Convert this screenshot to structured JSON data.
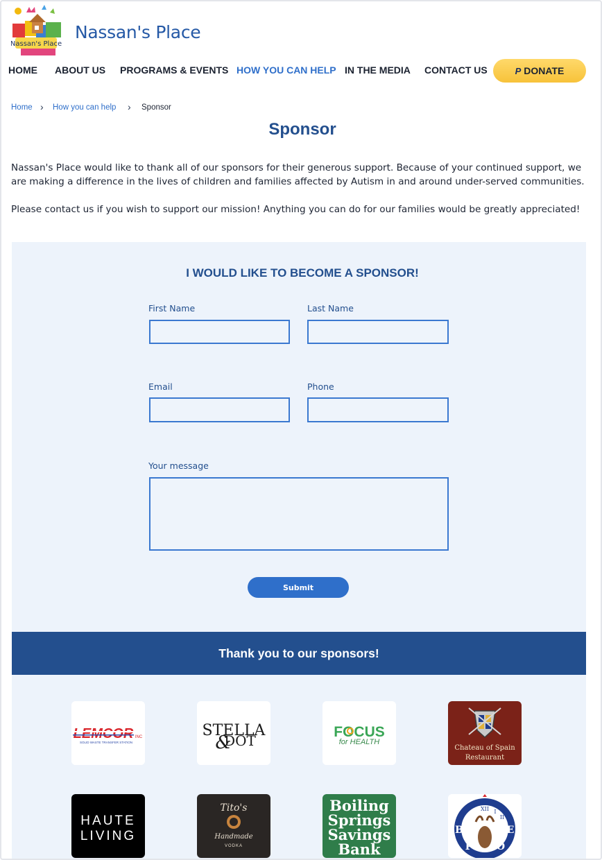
{
  "site": {
    "title": "Nassan's Place",
    "logo_text": "Nassan's Place"
  },
  "nav": {
    "items": [
      "HOME",
      "ABOUT US",
      "PROGRAMS & EVENTS",
      "HOW YOU CAN HELP",
      "IN THE MEDIA",
      "CONTACT US"
    ],
    "active": "HOW YOU CAN HELP",
    "donate_label": "DONATE",
    "donate_icon": "paypal-icon"
  },
  "breadcrumb": [
    "Home",
    "How you can help",
    "Sponsor"
  ],
  "page": {
    "title": "Sponsor",
    "intro": [
      "Nassan's Place would like to thank all of our sponsors for their generous support.  Because of your continued support, we are making a difference in the lives of children and families affected by Autism in and around under-served communities.",
      "Please contact us if you wish to support our mission!  Anything you can do for our families would be greatly appreciated!"
    ]
  },
  "form": {
    "heading": "I WOULD LIKE TO BECOME A SPONSOR!",
    "first_name_label": "First Name",
    "last_name_label": "Last Name",
    "email_label": "Email",
    "phone_label": "Phone",
    "message_label": "Your message",
    "first_name_value": "",
    "last_name_value": "",
    "email_value": "",
    "phone_value": "",
    "message_value": "",
    "submit_label": "Submit"
  },
  "sponsors": {
    "heading": "Thank you to our sponsors!",
    "logos": [
      {
        "lines": [
          "LEMCOR",
          "INC",
          "SOLID WASTE TRANSFER STATION"
        ]
      },
      {
        "lines": [
          "STELLA",
          "&",
          "DOT"
        ]
      },
      {
        "lines": [
          "FOCUS",
          "for HEALTH"
        ]
      },
      {
        "lines": [
          "Chateau of Spain",
          "Restaurant"
        ]
      },
      {
        "lines": [
          "HAUTE",
          "LIVING"
        ]
      },
      {
        "lines": [
          "Tito's",
          "Handmade",
          "VODKA"
        ]
      },
      {
        "lines": [
          "Boiling",
          "Springs",
          "Savings",
          "Bank"
        ]
      },
      {
        "lines": [
          "B",
          "P",
          "O",
          "E",
          "XII",
          "I",
          "II"
        ]
      }
    ]
  },
  "colors": {
    "brand_blue": "#234f8e",
    "link_blue": "#2f6fca",
    "donate_yellow": "#f7c23a",
    "panel_bg": "#edf3fb"
  }
}
